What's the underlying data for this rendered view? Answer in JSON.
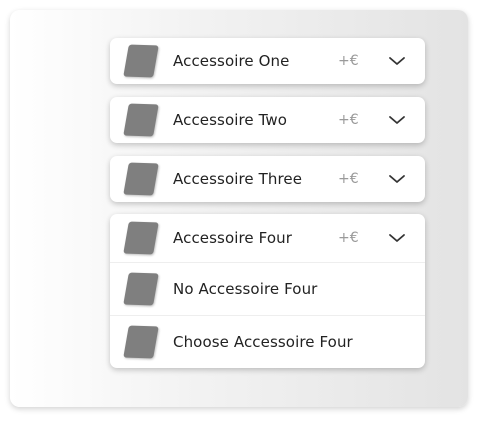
{
  "accessories": [
    {
      "label": "Accessoire One",
      "price": "+€"
    },
    {
      "label": "Accessoire Two",
      "price": "+€"
    },
    {
      "label": "Accessoire Three",
      "price": "+€"
    },
    {
      "label": "Accessoire Four",
      "price": "+€"
    }
  ],
  "options_four": [
    {
      "label": "No Accessoire Four"
    },
    {
      "label": "Choose Accessoire Four"
    }
  ],
  "icons": {
    "thumbnail": "product-thumbnail-icon",
    "expand": "chevron-down-icon"
  },
  "colors": {
    "thumbnail": "#7f7f7f",
    "price": "#9a9a9a",
    "text": "#222222"
  }
}
